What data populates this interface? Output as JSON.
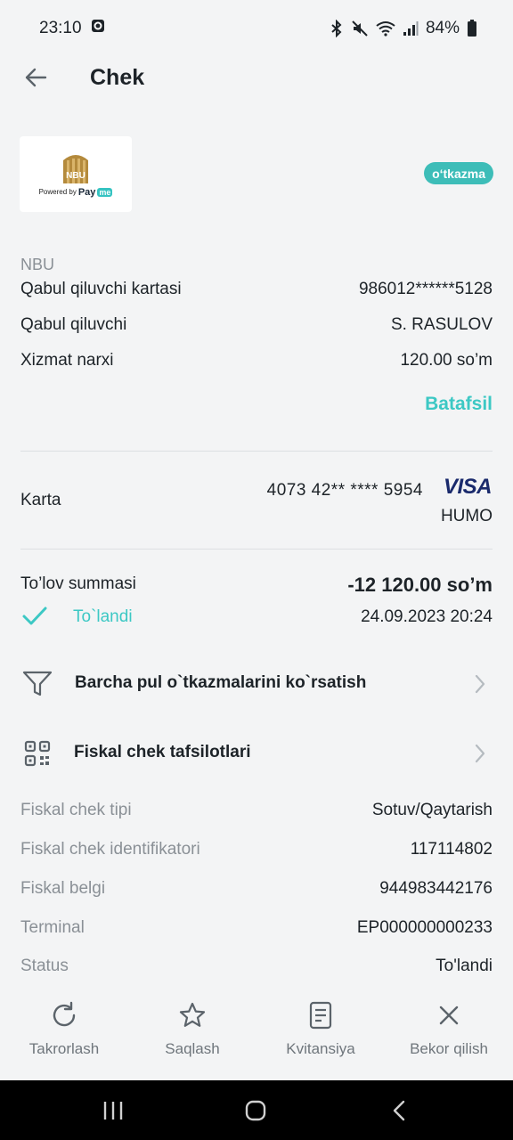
{
  "status_bar": {
    "time": "23:10",
    "battery": "84%",
    "icons": [
      "bluetooth-icon",
      "mute-icon",
      "wifi-icon",
      "signal-icon",
      "battery-icon"
    ]
  },
  "header": {
    "title": "Chek"
  },
  "merchant": {
    "logo_text": "NBU",
    "powered_by": "Powered by",
    "pay_word": "Pay",
    "me_word": "me",
    "type_badge": "o‘tkazma",
    "name": "NBU"
  },
  "details": [
    {
      "label": "Qabul qiluvchi kartasi",
      "value": "986012******5128"
    },
    {
      "label": "Qabul qiluvchi",
      "value": "S. RASULOV"
    },
    {
      "label": "Xizmat narxi",
      "value": "120.00 so’m"
    }
  ],
  "more_link": "Batafsil",
  "card": {
    "label": "Karta",
    "number": "4073 42** **** 5954",
    "brand": "VISA",
    "system": "HUMO"
  },
  "payment": {
    "label": "To’lov summasi",
    "amount": "-12 120.00 so’m",
    "status": "To`landi",
    "datetime": "24.09.2023 20:24"
  },
  "nav_items": {
    "all_transfers": "Barcha pul o`tkazmalarini ko`rsatish",
    "fiscal_details": "Fiskal chek tafsilotlari"
  },
  "fiscal": [
    {
      "label": "Fiskal chek tipi",
      "value": "Sotuv/Qaytarish"
    },
    {
      "label": "Fiskal chek identifikatori",
      "value": "117114802"
    },
    {
      "label": "Fiskal belgi",
      "value": "944983442176"
    },
    {
      "label": "Terminal",
      "value": "EP000000000233"
    },
    {
      "label": "Status",
      "value": "To'landi"
    }
  ],
  "actions": {
    "repeat": "Takrorlash",
    "save": "Saqlash",
    "receipt": "Kvitansiya",
    "cancel": "Bekor qilish"
  },
  "colors": {
    "accent": "#3cc8c4",
    "badge": "#3dbdb8",
    "text": "#1d2328",
    "muted": "#8a9096",
    "background": "#f3f4f5"
  }
}
